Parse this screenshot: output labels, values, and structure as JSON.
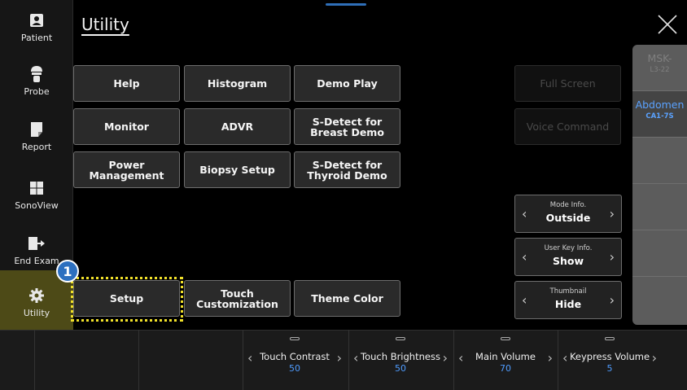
{
  "header": {
    "title": "Utility",
    "close_icon": "close-x-icon"
  },
  "sidebar": {
    "items": [
      {
        "label": "Patient",
        "icon": "patient-icon"
      },
      {
        "label": "Probe",
        "icon": "probe-icon"
      },
      {
        "label": "Report",
        "icon": "report-icon"
      },
      {
        "label": "SonoView",
        "icon": "sonoview-icon"
      },
      {
        "label": "End Exam",
        "icon": "end-exam-icon"
      },
      {
        "label": "Utility",
        "icon": "gear-icon",
        "active": true
      }
    ]
  },
  "utility_buttons": {
    "help": "Help",
    "histogram": "Histogram",
    "demo_play": "Demo Play",
    "monitor": "Monitor",
    "advr": "ADVR",
    "s_detect_breast": "S-Detect for Breast Demo",
    "power_management": "Power Management",
    "biopsy_setup": "Biopsy Setup",
    "s_detect_thyroid": "S-Detect for Thyroid Demo",
    "setup": "Setup",
    "touch_customization": "Touch Customization",
    "theme_color": "Theme Color",
    "full_screen": "Full Screen",
    "voice_command": "Voice Command"
  },
  "callout": {
    "badge": "1",
    "highlight_color": "#f1e12a"
  },
  "info_selectors": [
    {
      "title": "Mode Info.",
      "value": "Outside"
    },
    {
      "title": "User Key Info.",
      "value": "Show"
    },
    {
      "title": "Thumbnail",
      "value": "Hide"
    }
  ],
  "probes": [
    {
      "name": "MSK-",
      "model": "L3-22",
      "state": "dim"
    },
    {
      "name": "Abdomen",
      "model": "CA1-7S",
      "state": "selected"
    }
  ],
  "bottom_controls": [
    {
      "label": "Touch Contrast",
      "value": "50"
    },
    {
      "label": "Touch Brightness",
      "value": "50"
    },
    {
      "label": "Main Volume",
      "value": "70"
    },
    {
      "label": "Keypress Volume",
      "value": "5"
    }
  ],
  "colors": {
    "accent_blue": "#4f9cff",
    "active_sidebar": "#4d4a17",
    "badge_blue": "#2c6fbf"
  }
}
